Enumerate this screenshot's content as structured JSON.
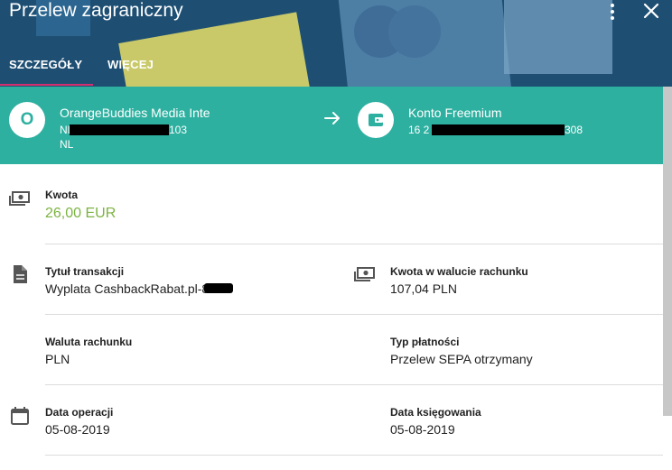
{
  "header": {
    "title": "Przelew zagraniczny",
    "tabs": [
      {
        "label": "SZCZEGÓŁY",
        "active": true
      },
      {
        "label": "WIĘCEJ",
        "active": false
      }
    ]
  },
  "transfer": {
    "sender": {
      "initial": "O",
      "name": "OrangeBuddies Media Inte",
      "account_prefix": "NL",
      "account_suffix": "103",
      "country": "NL"
    },
    "recipient": {
      "name": "Konto Freemium",
      "account_prefix": "16 2",
      "account_suffix": "308"
    }
  },
  "details": {
    "amount": {
      "label": "Kwota",
      "value": "26,00 EUR"
    },
    "title": {
      "label": "Tytuł transakcji",
      "value": "Wyplata CashbackRabat.pl-8"
    },
    "account_amount": {
      "label": "Kwota w walucie rachunku",
      "value": "107,04 PLN"
    },
    "account_currency": {
      "label": "Waluta rachunku",
      "value": "PLN"
    },
    "payment_type": {
      "label": "Typ płatności",
      "value": "Przelew SEPA otrzymany"
    },
    "operation_date": {
      "label": "Data operacji",
      "value": "05-08-2019"
    },
    "booking_date": {
      "label": "Data księgowania",
      "value": "05-08-2019"
    }
  },
  "colors": {
    "header_bg": "#1e4f73",
    "band_bg": "#2eb0a0",
    "amount_green": "#7cb342",
    "tab_indicator": "#d2306e"
  }
}
